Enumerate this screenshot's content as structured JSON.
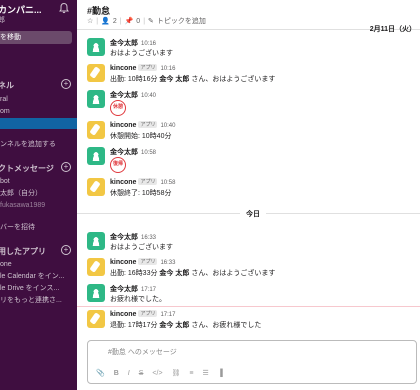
{
  "sidebar": {
    "workspace_name": "カンパニ...",
    "workspace_user": "郎",
    "jump_label": "を移動",
    "channels_title": "ネル",
    "channels": [
      "ral",
      "om",
      ""
    ],
    "add_channel": "ンネルを追加する",
    "dm_title": "クトメッセージ",
    "dms": [
      "bot",
      "太郎（自分）",
      "fukasawa1989"
    ],
    "invite": "バーを招待",
    "apps_title": "用したアプリ",
    "apps": [
      "one",
      "le Calendar をイン...",
      "le Drive をインス...",
      "リをもっと連携さ..."
    ]
  },
  "channel": {
    "title": "#勤怠",
    "members": "2",
    "pins": "0",
    "topic_label": "トピックを追加"
  },
  "date_label": "2月11日（火）",
  "today_label": "今日",
  "messages": [
    {
      "sender": "金今太郎",
      "time": "10:16",
      "body": "おはようございます",
      "avatar": "green"
    },
    {
      "sender": "kincone",
      "badge": "アプリ",
      "time": "10:16",
      "body_pre": "出勤: 10時16分",
      "mention": "金今 太郎",
      "body_post": "さん、おはようございます",
      "avatar": "yellow"
    },
    {
      "sender": "金今太郎",
      "time": "10:40",
      "stamp": "休憩",
      "avatar": "green"
    },
    {
      "sender": "kincone",
      "badge": "アプリ",
      "time": "10:40",
      "body": "休憩開始: 10時40分",
      "avatar": "yellow"
    },
    {
      "sender": "金今太郎",
      "time": "10:58",
      "stamp": "復帰",
      "avatar": "green"
    },
    {
      "sender": "kincone",
      "badge": "アプリ",
      "time": "10:58",
      "body": "休憩終了: 10時58分",
      "avatar": "yellow"
    },
    {
      "sender": "金今太郎",
      "time": "16:33",
      "body": "おはようございます",
      "avatar": "green"
    },
    {
      "sender": "kincone",
      "badge": "アプリ",
      "time": "16:33",
      "body_pre": "出勤: 16時33分",
      "mention": "金今 太郎",
      "body_post": "さん、おはようございます",
      "avatar": "yellow"
    },
    {
      "sender": "金今太郎",
      "time": "17:17",
      "body": "お疲れ様でした。",
      "avatar": "green"
    },
    {
      "sender": "kincone",
      "badge": "アプリ",
      "time": "17:17",
      "body_pre": "退勤: 17時17分",
      "mention": "金今 太郎",
      "body_post": "さん、お疲れ様でした",
      "avatar": "yellow"
    }
  ],
  "composer": {
    "placeholder": "#勤怠 へのメッセージ"
  },
  "colors": {
    "sidebar_bg": "#3f0e40",
    "active_item": "#1164a3",
    "stamp_red": "#e0393e"
  }
}
